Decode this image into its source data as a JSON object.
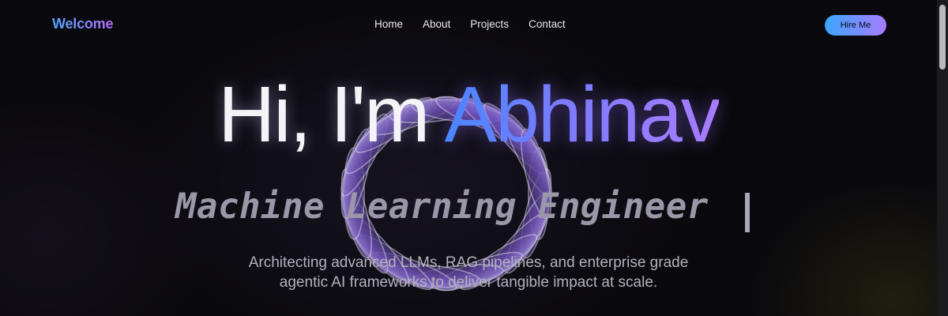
{
  "nav": {
    "brand": "Welcome",
    "links": [
      "Home",
      "About",
      "Projects",
      "Contact"
    ],
    "cta": "Hire Me"
  },
  "hero": {
    "greeting": "Hi, I'm ",
    "name": "Abhinav",
    "role": "Machine Learning Engineer",
    "description_line1": "Architecting advanced LLMs, RAG pipelines, and enterprise grade",
    "description_line2": "agentic AI frameworks to deliver tangible impact at scale."
  },
  "colors": {
    "background": "#0a090d",
    "accent_blue": "#4a86ff",
    "accent_purple": "#a97cff"
  }
}
